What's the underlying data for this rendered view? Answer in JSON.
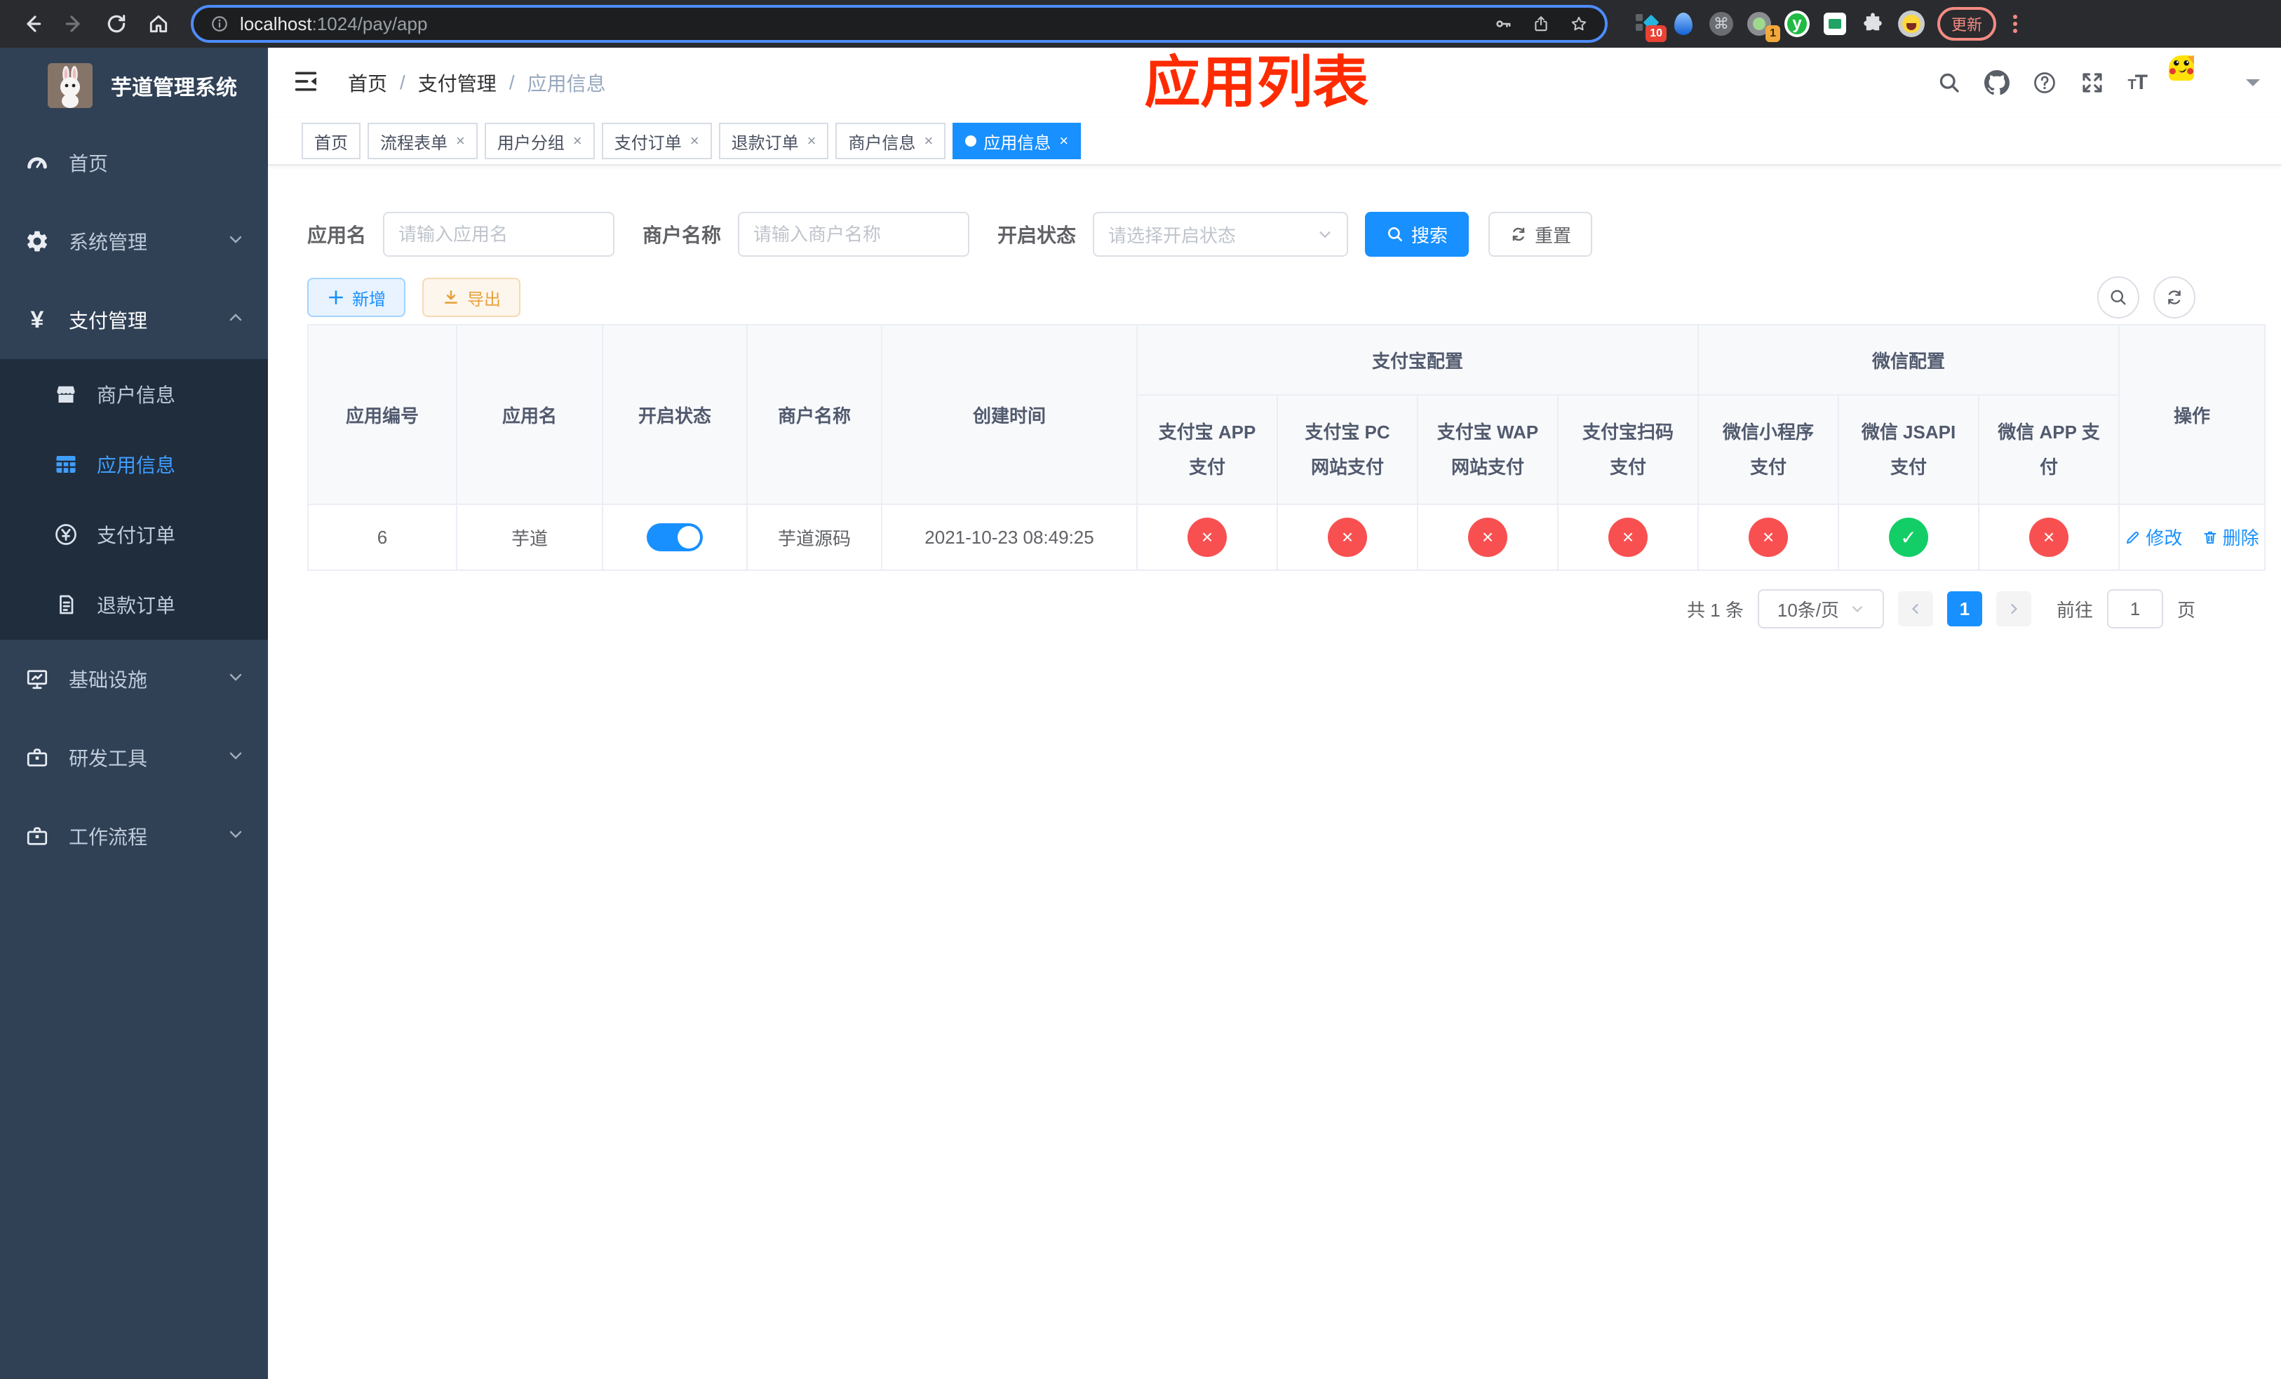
{
  "browser": {
    "url_host": "localhost",
    "url_path": ":1024/pay/app",
    "update_label": "更新",
    "ext_badge_devtools": "10",
    "ext_badge_proxy": "1",
    "ext_y_letter": "y",
    "command_glyph": "⌘"
  },
  "sidebar": {
    "title": "芋道管理系统",
    "items": [
      {
        "label": "首页"
      },
      {
        "label": "系统管理"
      },
      {
        "label": "支付管理"
      },
      {
        "label": "基础设施"
      },
      {
        "label": "研发工具"
      },
      {
        "label": "工作流程"
      }
    ],
    "submenu": [
      {
        "label": "商户信息"
      },
      {
        "label": "应用信息"
      },
      {
        "label": "支付订单"
      },
      {
        "label": "退款订单"
      }
    ]
  },
  "header": {
    "breadcrumb": [
      "首页",
      "支付管理",
      "应用信息"
    ],
    "watermark": "应用列表"
  },
  "tabs": [
    {
      "label": "首页",
      "closable": false,
      "active": false
    },
    {
      "label": "流程表单",
      "closable": true,
      "active": false
    },
    {
      "label": "用户分组",
      "closable": true,
      "active": false
    },
    {
      "label": "支付订单",
      "closable": true,
      "active": false
    },
    {
      "label": "退款订单",
      "closable": true,
      "active": false
    },
    {
      "label": "商户信息",
      "closable": true,
      "active": false
    },
    {
      "label": "应用信息",
      "closable": true,
      "active": true
    }
  ],
  "filters": {
    "app_name_label": "应用名",
    "app_name_placeholder": "请输入应用名",
    "merchant_label": "商户名称",
    "merchant_placeholder": "请输入商户名称",
    "status_label": "开启状态",
    "status_placeholder": "请选择开启状态",
    "search_label": "搜索",
    "reset_label": "重置"
  },
  "toolbar": {
    "add_label": "新增",
    "export_label": "导出"
  },
  "table": {
    "simple_columns": [
      "应用编号",
      "应用名",
      "开启状态",
      "商户名称",
      "创建时间"
    ],
    "groups": [
      {
        "label": "支付宝配置",
        "children": [
          "支付宝 APP 支付",
          "支付宝 PC 网站支付",
          "支付宝 WAP 网站支付",
          "支付宝扫码支付"
        ]
      },
      {
        "label": "微信配置",
        "children": [
          "微信小程序支付",
          "微信 JSAPI 支付",
          "微信 APP 支付"
        ]
      }
    ],
    "actions_column": "操作",
    "row": {
      "id": "6",
      "name": "芋道",
      "enabled": true,
      "merchant": "芋道源码",
      "created": "2021-10-23 08:49:25",
      "statuses": [
        {
          "name": "alipay-app",
          "ok": false,
          "symbol": "×"
        },
        {
          "name": "alipay-pc",
          "ok": false,
          "symbol": "×"
        },
        {
          "name": "alipay-wap",
          "ok": false,
          "symbol": "×"
        },
        {
          "name": "alipay-qr",
          "ok": false,
          "symbol": "×"
        },
        {
          "name": "wechat-lite",
          "ok": false,
          "symbol": "×"
        },
        {
          "name": "wechat-jsapi",
          "ok": true,
          "symbol": "✓"
        },
        {
          "name": "wechat-app",
          "ok": false,
          "symbol": "×"
        }
      ],
      "edit_label": "修改",
      "delete_label": "删除"
    }
  },
  "pagination": {
    "total": "共 1 条",
    "page_size": "10条/页",
    "current_page": "1",
    "goto_label": "前往",
    "goto_value": "1",
    "page_unit": "页"
  },
  "icons": {
    "close": "×"
  },
  "colors": {
    "primary": "#1890ff",
    "menu_active": "#409eff",
    "sidebar_bg": "#304156",
    "submenu_bg": "#1f2d3d",
    "danger": "#f85050",
    "success": "#13ce66",
    "warning": "#e6a23c",
    "watermark_red": "#fe2b00"
  }
}
